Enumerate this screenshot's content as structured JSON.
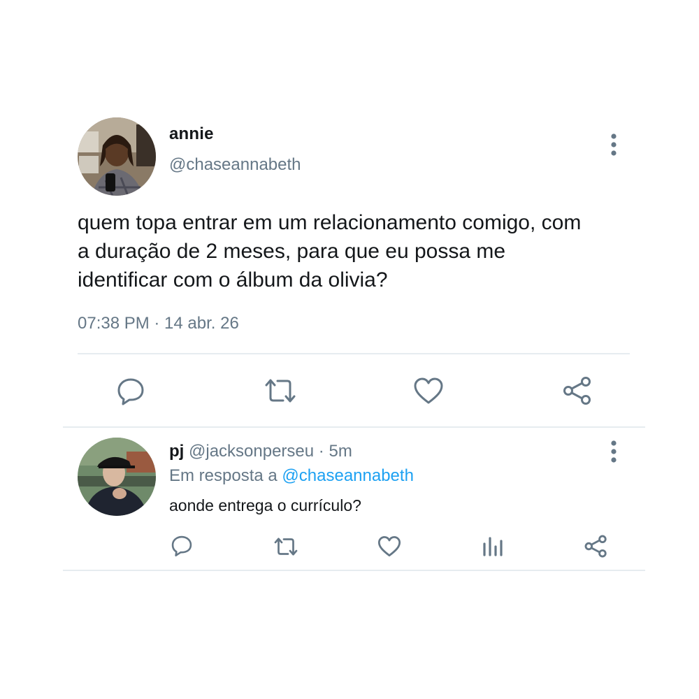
{
  "main_tweet": {
    "avatar_icon": "user-avatar-photo",
    "display_name": "annie",
    "handle": "@chaseannabeth",
    "text_lines": [
      "quem topa entrar em um relacionamento comigo, com",
      "a duração de 2 meses, para que eu possa me",
      "identificar com o álbum da olivia?"
    ],
    "timestamp": "07:38 PM · 14 abr. 26",
    "actions": [
      "reply-icon",
      "retweet-icon",
      "like-icon",
      "share-icon"
    ]
  },
  "reply": {
    "avatar_icon": "user-avatar-photo",
    "display_name": "pj",
    "handle": "@jacksonperseu",
    "separator": "·",
    "time": "5m",
    "in_reply_prefix": "Em resposta a",
    "in_reply_mention": "@chaseannabeth",
    "text": "aonde entrega o currículo?",
    "actions": [
      "reply-icon",
      "retweet-icon",
      "like-icon",
      "analytics-icon",
      "share-icon"
    ]
  },
  "colors": {
    "text_primary": "#14171a",
    "text_secondary": "#657786",
    "icon": "#657786",
    "link": "#1da1f2",
    "divider": "#e6ecf0",
    "background": "#ffffff"
  }
}
